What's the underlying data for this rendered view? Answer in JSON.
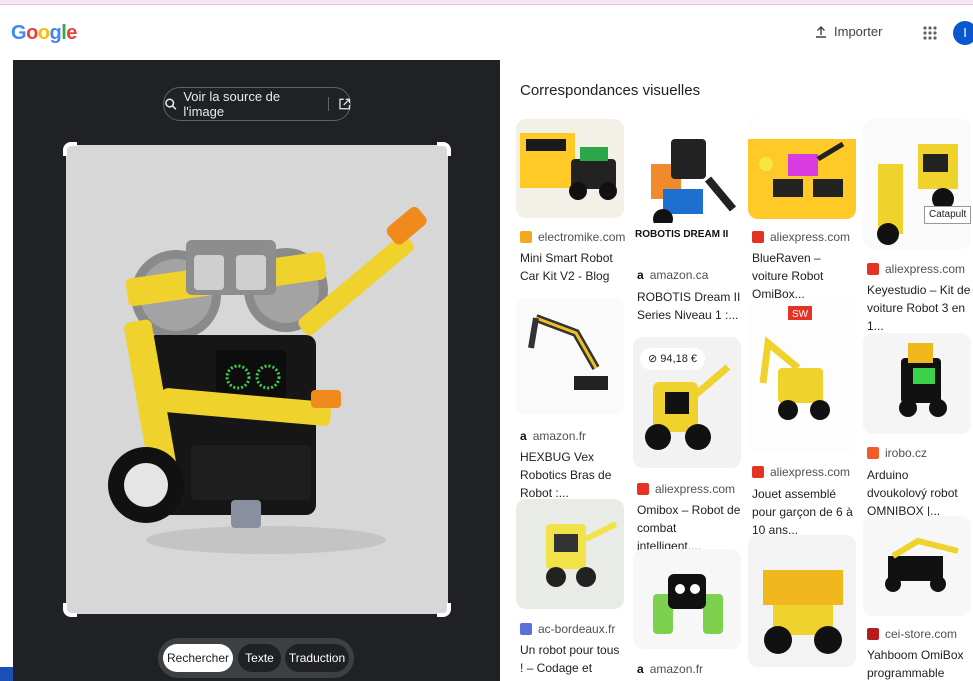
{
  "header": {
    "logo_text": "Google",
    "logo_colors": [
      "#4285f4",
      "#ea4335",
      "#fbbc05",
      "#4285f4",
      "#34a853",
      "#ea4335"
    ],
    "import_label": "Importer",
    "import_icon": "upload-icon",
    "apps_icon": "apps-grid-icon",
    "avatar_letter": "I"
  },
  "left": {
    "source_button_label": "Voir la source de l'image",
    "source_icon": "lens-icon",
    "open_icon": "open-in-new-icon",
    "tabs": [
      {
        "label": "Rechercher",
        "active": true
      },
      {
        "label": "Texte",
        "active": false
      },
      {
        "label": "Traduction",
        "active": false
      }
    ]
  },
  "results": {
    "title": "Correspondances visuelles",
    "price_badge": "94,18 €",
    "catapult_label": "Catapult",
    "dream_label": "ROBOTIS DREAM II",
    "sw_label": "SW",
    "items": [
      {
        "source": "electromike.com",
        "title": "Mini Smart Robot Car Kit V2 - Blog",
        "color": "#f5a623"
      },
      {
        "source": "amazon.fr",
        "title": "HEXBUG Vex Robotics Bras de Robot :...",
        "color": "#111111"
      },
      {
        "source": "ac-bordeaux.fr",
        "title": "Un robot pour tous ! – Codage et robotiqu...",
        "color": "#5b6fd6"
      },
      {
        "source": "amazon.ca",
        "title": "ROBOTIS Dream II Series Niveau 1 :...",
        "color": "#111111"
      },
      {
        "source": "aliexpress.com",
        "title": "Omibox – Robot de combat intelligent,...",
        "color": "#e43225"
      },
      {
        "source": "amazon.fr",
        "title": "",
        "color": "#111111"
      },
      {
        "source": "aliexpress.com",
        "title": "BlueRaven – voiture Robot OmiBox...",
        "color": "#e43225"
      },
      {
        "source": "aliexpress.com",
        "title": "Jouet assemblé pour garçon de 6 à 10 ans...",
        "color": "#e43225"
      },
      {
        "source": "aliexpress.com",
        "title": "Keyestudio – Kit de voiture Robot 3 en 1...",
        "color": "#e43225"
      },
      {
        "source": "irobo.cz",
        "title": "Arduino dvoukolový robot OMNIBOX |...",
        "color": "#f25c2a"
      },
      {
        "source": "cei-store.com",
        "title": "Yahboom OmiBox programmable cute...",
        "color": "#b71c1c"
      }
    ]
  }
}
